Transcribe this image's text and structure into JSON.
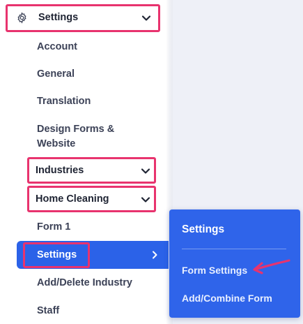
{
  "sidebar": {
    "header": {
      "label": "Settings",
      "icon": "gear-icon",
      "chevron": "chevron-down-icon"
    },
    "items": [
      {
        "label": "Account"
      },
      {
        "label": "General"
      },
      {
        "label": "Translation"
      },
      {
        "label_line1": "Design Forms &",
        "label_line2": "Website"
      }
    ],
    "industries": {
      "label": "Industries",
      "chevron": "chevron-down-icon"
    },
    "home_cleaning": {
      "label": "Home Cleaning",
      "chevron": "chevron-down-icon"
    },
    "form1": {
      "label": "Form 1"
    },
    "settings_active": {
      "label": "Settings",
      "chevron": "chevron-right-icon"
    },
    "add_delete_industry": {
      "label": "Add/Delete Industry"
    },
    "staff": {
      "label": "Staff"
    }
  },
  "popup": {
    "title": "Settings",
    "items": [
      {
        "label": "Form Settings"
      },
      {
        "label": "Add/Combine Form"
      }
    ]
  },
  "colors": {
    "highlight": "#e8336e",
    "accent": "#2b62e8",
    "text": "#3c4257"
  }
}
